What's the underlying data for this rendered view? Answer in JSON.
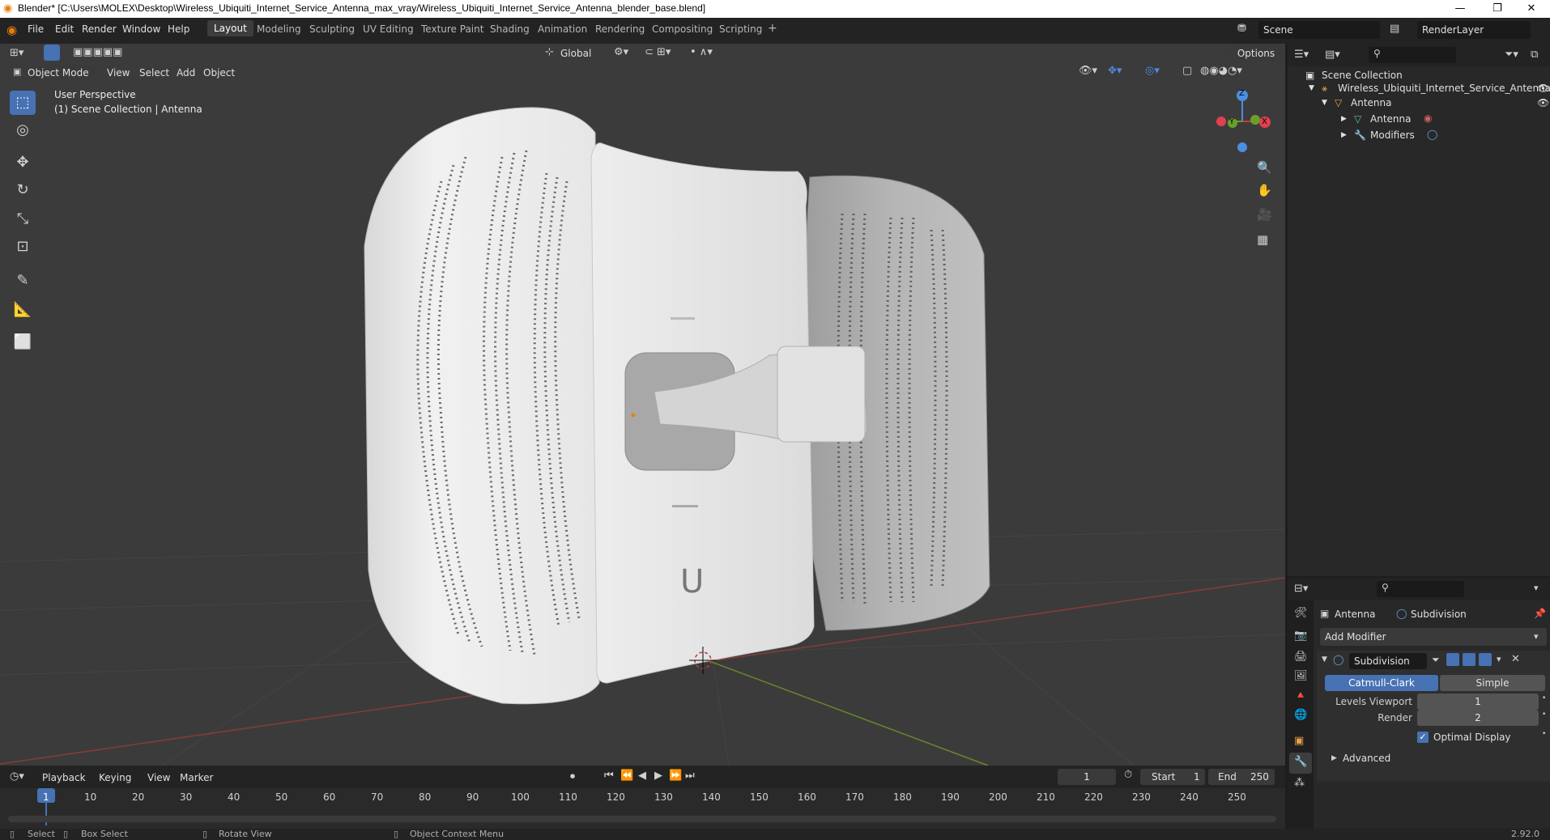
{
  "window": {
    "title": "Blender* [C:\\Users\\MOLEX\\Desktop\\Wireless_Ubiquiti_Internet_Service_Antenna_max_vray/Wireless_Ubiquiti_Internet_Service_Antenna_blender_base.blend]",
    "minimize": "—",
    "maximize": "❐",
    "close": "✕"
  },
  "menu": [
    "File",
    "Edit",
    "Render",
    "Window",
    "Help"
  ],
  "workspaces": [
    "Layout",
    "Modeling",
    "Sculpting",
    "UV Editing",
    "Texture Paint",
    "Shading",
    "Animation",
    "Rendering",
    "Compositing",
    "Scripting",
    "+"
  ],
  "scene": {
    "name": "Scene",
    "render_layer": "RenderLayer"
  },
  "viewport": {
    "mode": "Object Mode",
    "menus": [
      "View",
      "Select",
      "Add",
      "Object"
    ],
    "transform": "Global",
    "options": "Options",
    "overlay_line1": "User Perspective",
    "overlay_line2": "(1) Scene Collection | Antenna",
    "gizmo": {
      "z": "Z",
      "y": "Y",
      "x": "X"
    }
  },
  "outliner": {
    "root": "Scene Collection",
    "items": [
      {
        "label": "Wireless_Ubiquiti_Internet_Service_Antenna"
      },
      {
        "label": "Antenna"
      },
      {
        "label": "Antenna"
      },
      {
        "label": "Modifiers"
      }
    ]
  },
  "properties": {
    "object": "Antenna",
    "modifier_tab": "Subdivision",
    "add_modifier": "Add Modifier",
    "modifier_name": "Subdivision",
    "catmull": "Catmull-Clark",
    "simple": "Simple",
    "levels_label": "Levels Viewport",
    "levels_value": "1",
    "render_label": "Render",
    "render_value": "2",
    "optimal": "Optimal Display",
    "advanced": "Advanced"
  },
  "timeline": {
    "menus": [
      "Playback",
      "Keying",
      "View",
      "Marker"
    ],
    "current": "1",
    "start_label": "Start",
    "start": "1",
    "end_label": "End",
    "end": "250",
    "ticks": [
      "1",
      "10",
      "20",
      "30",
      "40",
      "50",
      "60",
      "70",
      "80",
      "90",
      "100",
      "110",
      "120",
      "130",
      "140",
      "150",
      "160",
      "170",
      "180",
      "190",
      "200",
      "210",
      "220",
      "230",
      "240",
      "250"
    ]
  },
  "status": {
    "select": "Select",
    "box_select": "Box Select",
    "rotate": "Rotate View",
    "context": "Object Context Menu",
    "version": "2.92.0"
  }
}
